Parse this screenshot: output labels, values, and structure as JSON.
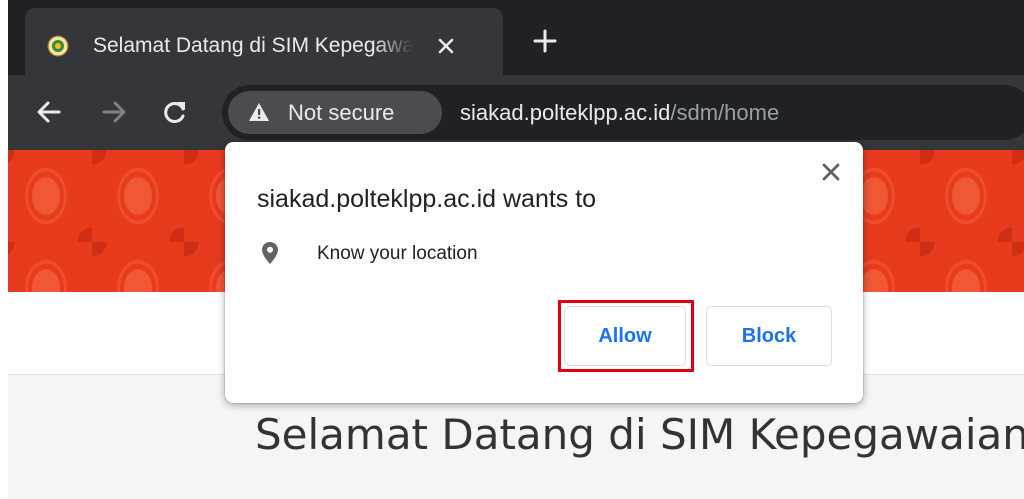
{
  "browser": {
    "tab": {
      "title": "Selamat Datang di SIM Kepegawaian",
      "favicon": "institution-seal-icon"
    },
    "new_tab_icon": "plus-icon",
    "nav": {
      "back_icon": "arrow-left-icon",
      "forward_icon": "arrow-right-icon",
      "reload_icon": "reload-icon"
    },
    "omnibox": {
      "security_chip_label": "Not secure",
      "security_icon": "warning-triangle-icon",
      "url_host": "siakad.polteklpp.ac.id",
      "url_path": "/sdm/home"
    }
  },
  "permission_dialog": {
    "title": "siakad.polteklpp.ac.id wants to",
    "permission_label": "Know your location",
    "permission_icon": "location-pin-icon",
    "allow_label": "Allow",
    "block_label": "Block",
    "close_icon": "close-icon",
    "highlight_color": "#e0000f",
    "button_text_color": "#1a73e8"
  },
  "page": {
    "heading": "Selamat Datang di SIM Kepegawaian",
    "banner_color": "#e83a1c"
  }
}
